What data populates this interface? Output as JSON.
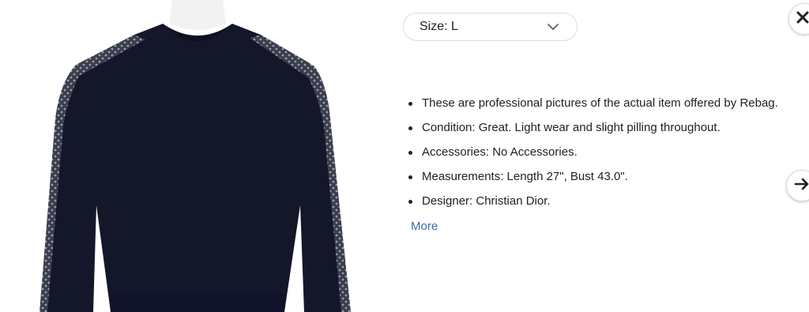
{
  "product": {
    "image_alt": "Christian Dior navy sweater with oblique print shoulder stripes",
    "colors": {
      "sweater": "#14172a",
      "stripe": "#2b2d3a",
      "mannequin": "#f2f2f2"
    }
  },
  "size_selector": {
    "label": "Size: L",
    "icon": "chevron-down-icon"
  },
  "close_button": {
    "icon": "close-icon"
  },
  "next_button": {
    "icon": "arrow-right-icon"
  },
  "details": {
    "items": [
      "These are professional pictures of the actual item offered by Rebag.",
      "Condition: Great. Light wear and slight pilling throughout.",
      "Accessories: No Accessories.",
      "Measurements: Length 27\", Bust 43.0\".",
      "Designer: Christian Dior."
    ],
    "more_label": "More",
    "link_color": "#3d6ba8"
  }
}
